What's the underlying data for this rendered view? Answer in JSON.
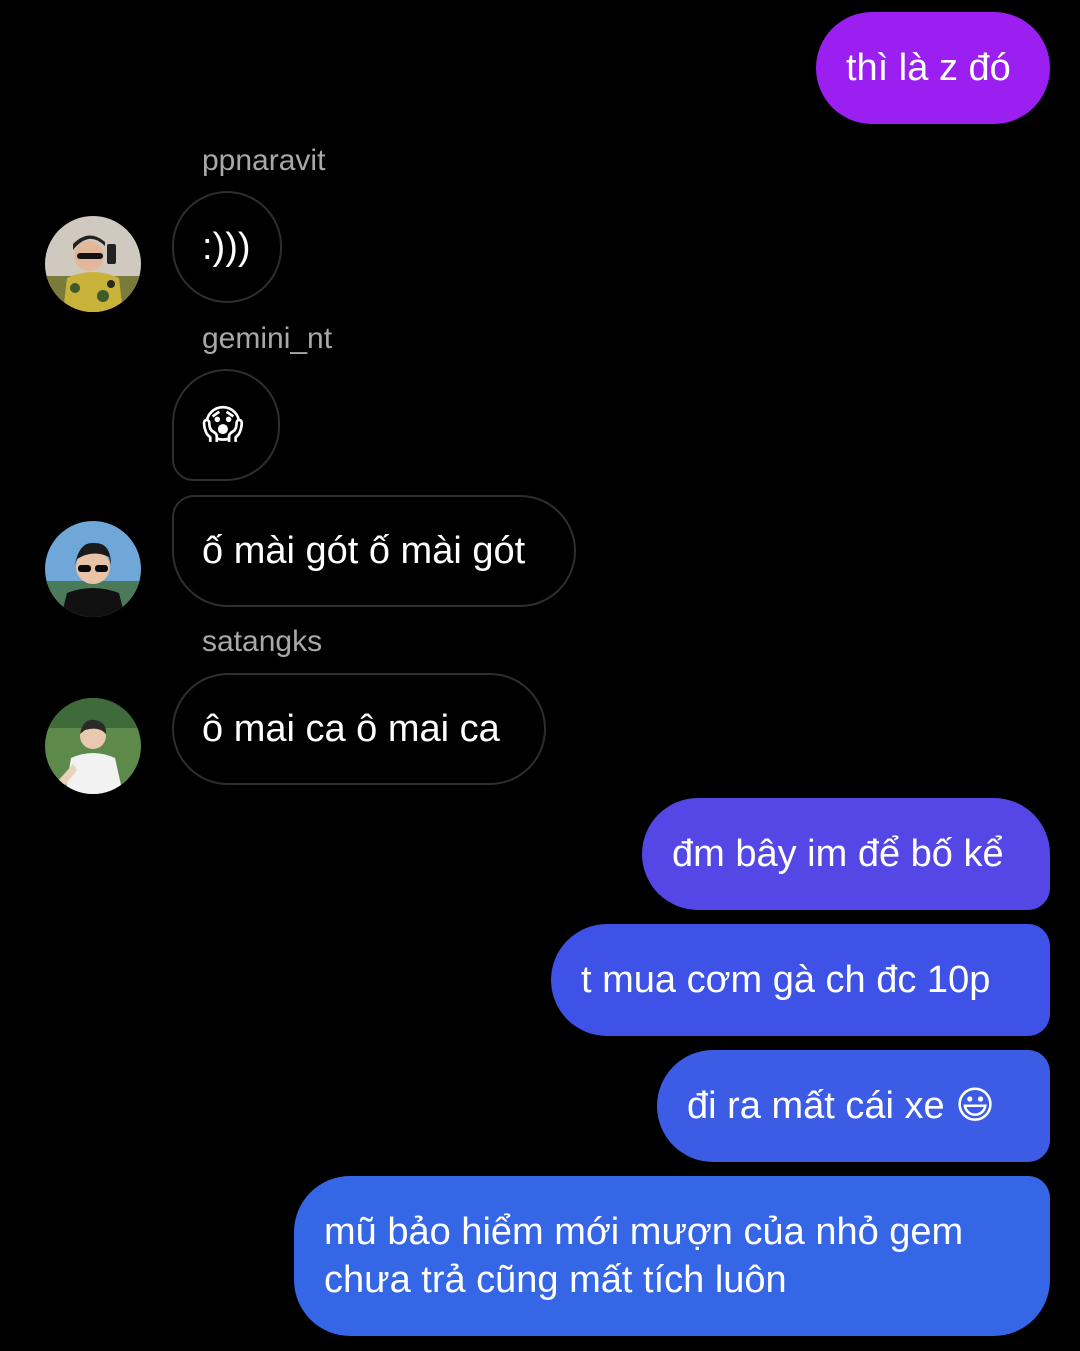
{
  "messages": {
    "m1": "thì là z đó",
    "m2": ":)))",
    "m3": "😱",
    "m4": "ố mài gót ố mài gót",
    "m5": "ô mai ca ô mai ca",
    "m6": "đm bây im để bố kể",
    "m7": "t mua cơm gà ch đc 10p",
    "m8": "đi ra mất cái xe 😃",
    "m9_line1": "mũ bảo hiểm mới mượn của nhỏ gem",
    "m9_line2": "chưa trả cũng mất tích luôn"
  },
  "senders": {
    "s1": "ppnaravit",
    "s2": "gemini_nt",
    "s3": "satangks"
  },
  "avatars": {
    "a1": "avatar-ppnaravit",
    "a2": "avatar-gemini_nt",
    "a3": "avatar-satangks"
  },
  "colors": {
    "background": "#000000",
    "outgoing_purple": "#9b1ff0",
    "outgoing_indigo": "#5447e6",
    "outgoing_blue": "#3d55e8",
    "outgoing_blue2": "#3c5ce6",
    "outgoing_blue3": "#3466e6",
    "incoming_border": "#2e2e2e",
    "sender_label": "#a8a8a8"
  }
}
